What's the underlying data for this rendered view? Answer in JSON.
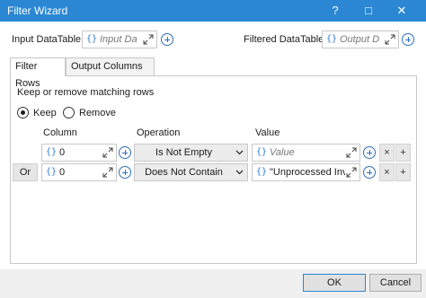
{
  "window": {
    "title": "Filter Wizard",
    "help_icon": "?",
    "maximize_icon": "□",
    "close_icon": "✕"
  },
  "input_datatable": {
    "label": "Input DataTable",
    "placeholder": "Input Da"
  },
  "filtered_datatable": {
    "label": "Filtered DataTable",
    "placeholder": "Output D"
  },
  "tabs": [
    {
      "label": "Filter Rows"
    },
    {
      "label": "Output Columns"
    }
  ],
  "filter": {
    "heading": "Keep or remove matching rows",
    "options": [
      {
        "label": "Keep",
        "selected": true
      },
      {
        "label": "Remove",
        "selected": false
      }
    ],
    "columns": {
      "column": "Column",
      "operation": "Operation",
      "value": "Value"
    },
    "rows": [
      {
        "connector": "",
        "column": "0",
        "operation": "Is Not Empty",
        "value": "",
        "value_placeholder": "Value"
      },
      {
        "connector": "Or",
        "column": "0",
        "operation": "Does Not Contain",
        "value": "\"Unprocessed Inv",
        "value_placeholder": ""
      }
    ],
    "remove_row_label": "×",
    "add_row_label": "+"
  },
  "buttons": {
    "ok": "OK",
    "cancel": "Cancel"
  },
  "colors": {
    "title_bar": "#2b87d3",
    "brace": "#2a7bd1"
  }
}
